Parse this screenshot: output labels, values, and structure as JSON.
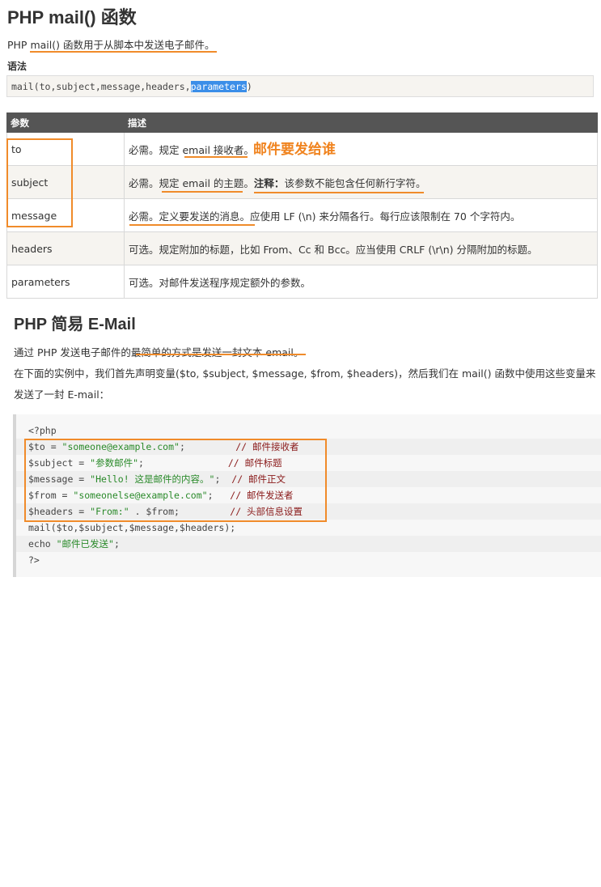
{
  "title": "PHP mail() 函数",
  "intro": "PHP mail() 函数用于从脚本中发送电子邮件。",
  "syntax": {
    "label": "语法",
    "code_before": "mail(to,subject,message,headers,",
    "code_selected": "parameters",
    "code_after": ")"
  },
  "table": {
    "headers": [
      "参数",
      "描述"
    ],
    "rows": [
      {
        "param": "to",
        "desc": "必需。规定 email 接收者。"
      },
      {
        "param": "subject",
        "desc_a": "必需。规定 email 的主题。",
        "desc_note": "注释：",
        "desc_b": "该参数不能包含任何新行字符。"
      },
      {
        "param": "message",
        "desc": "必需。定义要发送的消息。应使用 LF (\\n) 来分隔各行。每行应该限制在 70 个字符内。"
      },
      {
        "param": "headers",
        "desc": "可选。规定附加的标题，比如 From、Cc 和 Bcc。应当使用 CRLF (\\r\\n) 分隔附加的标题。"
      },
      {
        "param": "parameters",
        "desc": "可选。对邮件发送程序规定额外的参数。"
      }
    ]
  },
  "annotation": "邮件要发给谁",
  "section2": {
    "title": "PHP 简易 E-Mail",
    "para1": "通过 PHP 发送电子邮件的最简单的方式是发送一封文本 email。",
    "para2_line1": "在下面的实例中，我们首先声明变量($to, $subject, $message, $from, $headers)，然后我们在 mail() 函数中使用这些变量来",
    "para2_line2": "发送了一封 E-mail："
  },
  "code": {
    "lines": [
      {
        "parts": [
          {
            "t": "<?php",
            "k": "plain"
          }
        ]
      },
      {
        "parts": [
          {
            "t": "$to = ",
            "k": "var"
          },
          {
            "t": "\"someone@example.com\"",
            "k": "str"
          },
          {
            "t": ";         ",
            "k": "plain"
          },
          {
            "t": "// 邮件接收者",
            "k": "cmt"
          }
        ]
      },
      {
        "parts": [
          {
            "t": "$subject = ",
            "k": "var"
          },
          {
            "t": "\"参数邮件\"",
            "k": "str"
          },
          {
            "t": ";               ",
            "k": "plain"
          },
          {
            "t": "// 邮件标题",
            "k": "cmt"
          }
        ]
      },
      {
        "parts": [
          {
            "t": "$message = ",
            "k": "var"
          },
          {
            "t": "\"Hello! 这是邮件的内容。\"",
            "k": "str"
          },
          {
            "t": ";  ",
            "k": "plain"
          },
          {
            "t": "// 邮件正文",
            "k": "cmt"
          }
        ]
      },
      {
        "parts": [
          {
            "t": "$from = ",
            "k": "var"
          },
          {
            "t": "\"someonelse@example.com\"",
            "k": "str"
          },
          {
            "t": ";   ",
            "k": "plain"
          },
          {
            "t": "// 邮件发送者",
            "k": "cmt"
          }
        ]
      },
      {
        "parts": [
          {
            "t": "$headers = ",
            "k": "var"
          },
          {
            "t": "\"From:\"",
            "k": "str"
          },
          {
            "t": " . $from;         ",
            "k": "plain"
          },
          {
            "t": "// 头部信息设置",
            "k": "cmt"
          }
        ]
      },
      {
        "parts": [
          {
            "t": "mail($to,$subject,$message,$headers);",
            "k": "plain"
          }
        ]
      },
      {
        "parts": [
          {
            "t": "echo ",
            "k": "plain"
          },
          {
            "t": "\"邮件已发送\"",
            "k": "str"
          },
          {
            "t": ";",
            "k": "plain"
          }
        ]
      },
      {
        "parts": [
          {
            "t": "?>",
            "k": "plain"
          }
        ]
      }
    ]
  },
  "colors": {
    "accent": "#f08b2a",
    "table_header": "#555555",
    "code_string": "#2a8a2a",
    "code_comment": "#8a1a1a",
    "selection": "#3b8ee8"
  }
}
